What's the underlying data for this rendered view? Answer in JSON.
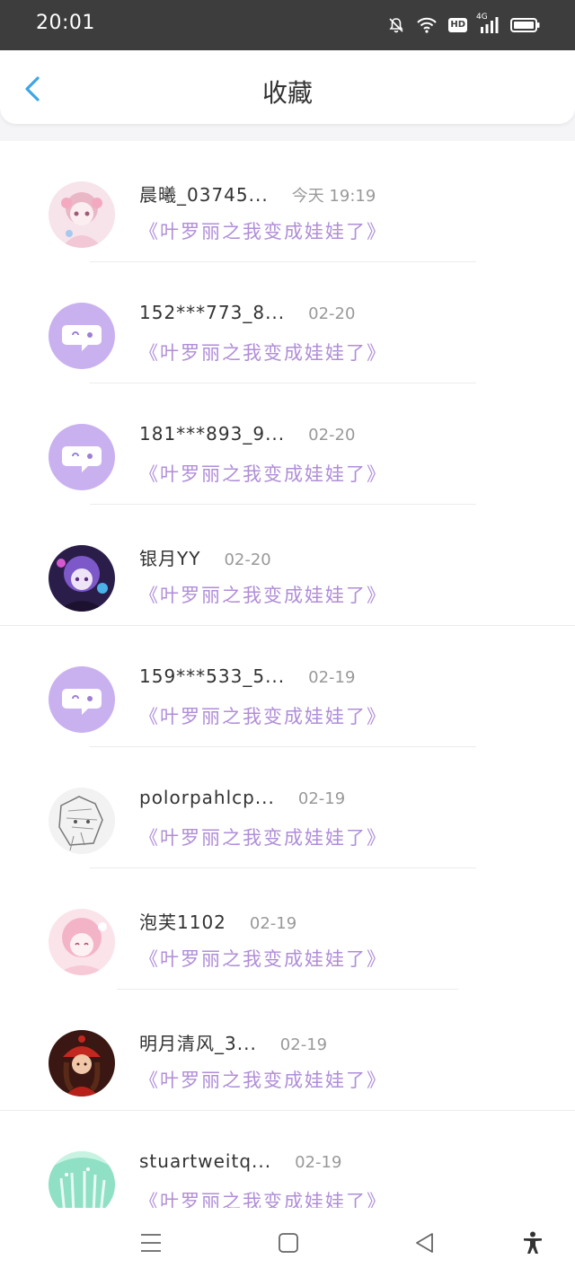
{
  "status_bar": {
    "time": "20:01",
    "hd_label": "HD",
    "network_label": "4G"
  },
  "header": {
    "title": "收藏"
  },
  "items": [
    {
      "name": "晨曦_03745...",
      "date": "今天 19:19",
      "book": "《叶罗丽之我变成娃娃了》",
      "avatar": "anime-girl-pink"
    },
    {
      "name": "152***773_8...",
      "date": "02-20",
      "book": "《叶罗丽之我变成娃娃了》",
      "avatar": "default-chat"
    },
    {
      "name": "181***893_9...",
      "date": "02-20",
      "book": "《叶罗丽之我变成娃娃了》",
      "avatar": "default-chat"
    },
    {
      "name": "银月YY",
      "date": "02-20",
      "book": "《叶罗丽之我变成娃娃了》",
      "avatar": "anime-girl-purple"
    },
    {
      "name": "159***533_5...",
      "date": "02-19",
      "book": "《叶罗丽之我变成娃娃了》",
      "avatar": "default-chat"
    },
    {
      "name": "polorpahlcp...",
      "date": "02-19",
      "book": "《叶罗丽之我变成娃娃了》",
      "avatar": "anime-sketch"
    },
    {
      "name": "泡芙1102",
      "date": "02-19",
      "book": "《叶罗丽之我变成娃娃了》",
      "avatar": "anime-girl-pink-hair"
    },
    {
      "name": "明月清风_3...",
      "date": "02-19",
      "book": "《叶罗丽之我变成娃娃了》",
      "avatar": "girl-red-hat"
    },
    {
      "name": "stuartweitq...",
      "date": "02-19",
      "book": "《叶罗丽之我变成娃娃了》",
      "avatar": "green-abstract"
    }
  ],
  "colors": {
    "accent_blue": "#3fa6e6",
    "book_purple": "#b08ed8",
    "avatar_lilac": "#c9b1ef"
  }
}
